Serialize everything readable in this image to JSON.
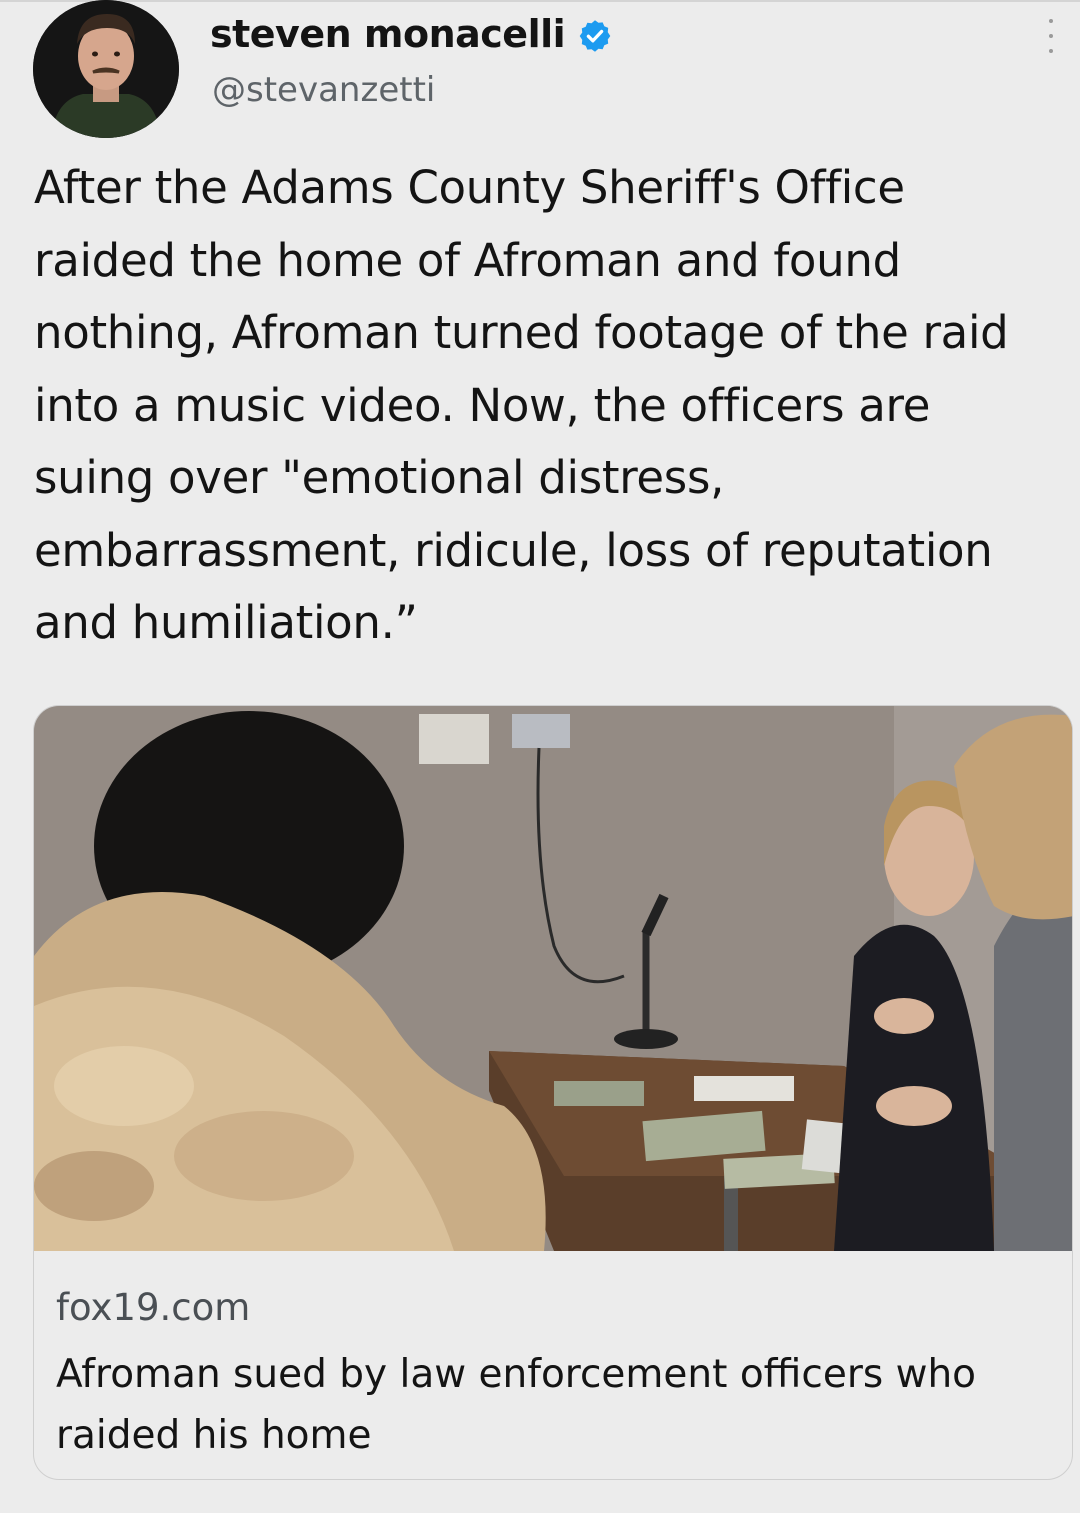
{
  "tweet": {
    "author_name": "steven monacelli",
    "verified": true,
    "handle": "@stevanzetti",
    "text": "After the Adams County Sheriff's Office raided the home of Afroman and found nothing, Afroman turned footage of the raid into a music video. Now, the officers are suing over \"emotional distress, embarrassment, ridicule, loss of reputation and humiliation.”"
  },
  "link_card": {
    "domain": "fox19.com",
    "title": "Afroman sued by law enforcement officers who raided his home"
  },
  "colors": {
    "background": "#ececec",
    "verified_badge": "#1d9bf0",
    "secondary_text": "#5e6469"
  },
  "icons": {
    "verified": "verified-badge-icon",
    "more": "more-options-icon"
  }
}
